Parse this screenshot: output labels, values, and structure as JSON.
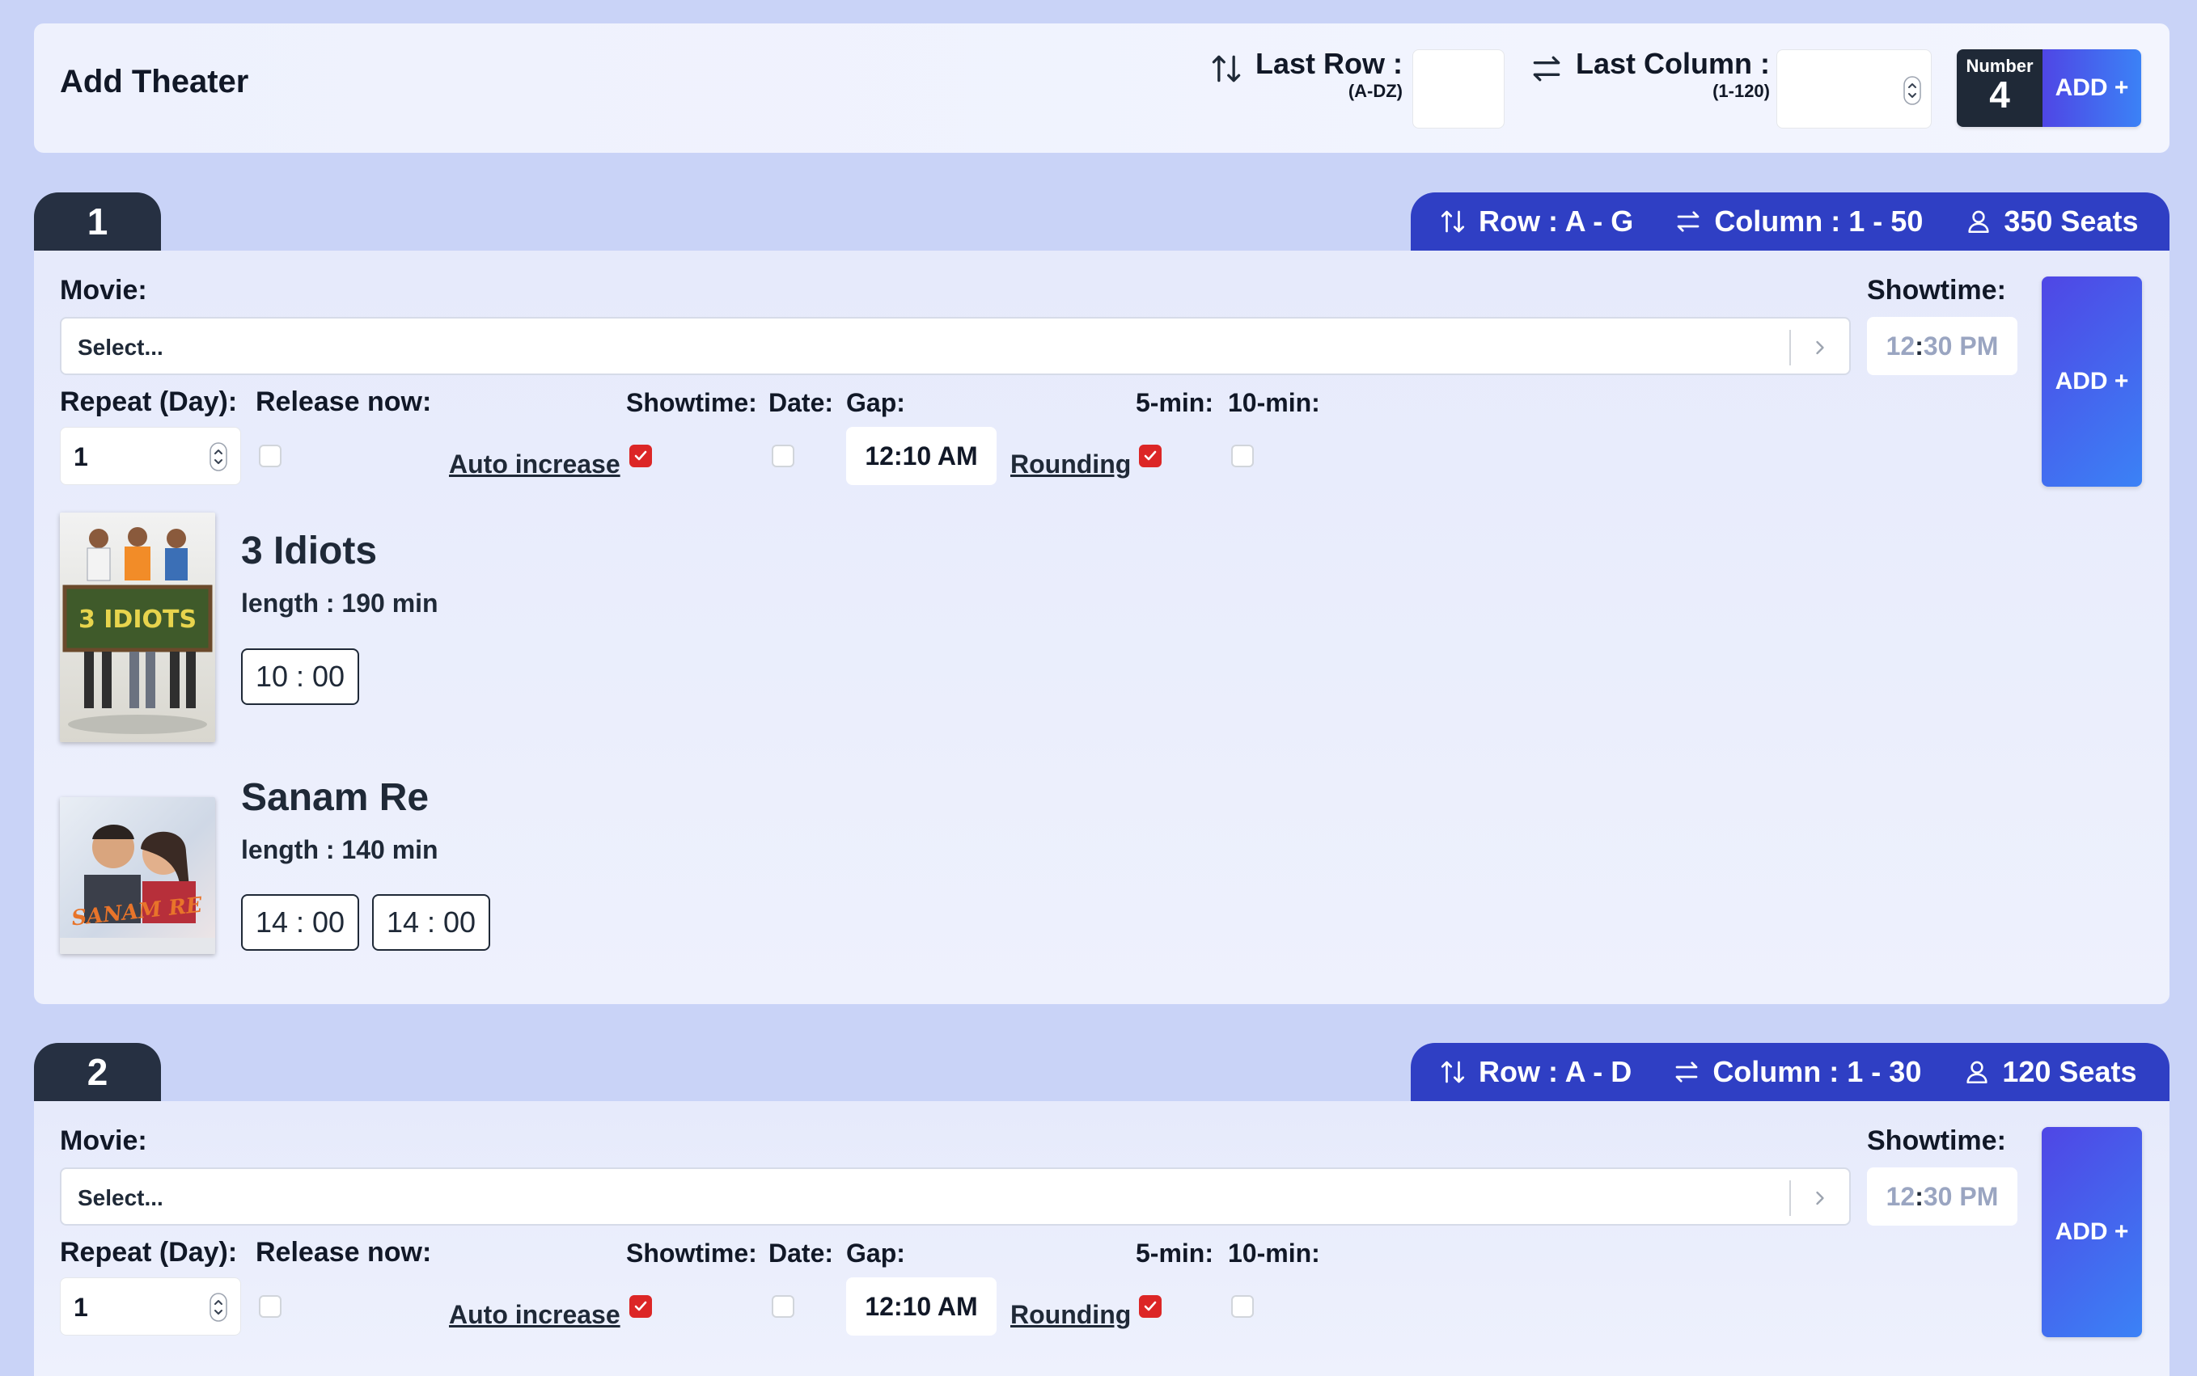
{
  "header": {
    "title": "Add Theater",
    "last_row_label": "Last Row :",
    "last_row_range": "(A-DZ)",
    "last_col_label": "Last Column :",
    "last_col_range": "(1-120)",
    "number_caption": "Number",
    "number_value": "4",
    "add_label": "ADD +"
  },
  "icons": {
    "row": "arrows-up-down-icon",
    "column": "arrows-left-right-icon",
    "seats": "user-icon",
    "chevron": "chevron-right-icon"
  },
  "colors": {
    "background": "#c9d3f7",
    "tab_dark": "#263042",
    "info_bar": "#2f3fc4",
    "add_gradient_start": "#4f46e5",
    "add_gradient_end": "#3b82f6",
    "checkbox_checked": "#dc2626"
  },
  "theaters": [
    {
      "number": "1",
      "row_info": "Row : A - G",
      "column_info": "Column : 1 - 50",
      "seats_info": "350 Seats",
      "movie_label": "Movie:",
      "movie_placeholder": "Select...",
      "showtime_label": "Showtime:",
      "showtime_hour": "12",
      "showtime_rest": "30 PM",
      "add_label": "ADD +",
      "repeat_label": "Repeat (Day):",
      "repeat_value": "1",
      "release_label": "Release now:",
      "auto_increase_label": "Auto increase",
      "showtime_check_label": "Showtime:",
      "date_label": "Date:",
      "gap_label": "Gap:",
      "gap_value": "12:10 AM",
      "rounding_label": "Rounding",
      "five_min_label": "5-min:",
      "ten_min_label": "10-min:",
      "movies": [
        {
          "title": "3 Idiots",
          "length": "length : 190 min",
          "times": [
            "10 : 00"
          ]
        },
        {
          "title": "Sanam Re",
          "length": "length : 140 min",
          "times": [
            "14 : 00",
            "14 : 00"
          ]
        }
      ]
    },
    {
      "number": "2",
      "row_info": "Row : A - D",
      "column_info": "Column : 1 - 30",
      "seats_info": "120 Seats",
      "movie_label": "Movie:",
      "movie_placeholder": "Select...",
      "showtime_label": "Showtime:",
      "showtime_hour": "12",
      "showtime_rest": "30 PM",
      "add_label": "ADD +",
      "repeat_label": "Repeat (Day):",
      "repeat_value": "1",
      "release_label": "Release now:",
      "auto_increase_label": "Auto increase",
      "showtime_check_label": "Showtime:",
      "date_label": "Date:",
      "gap_label": "Gap:",
      "gap_value": "12:10 AM",
      "rounding_label": "Rounding",
      "five_min_label": "5-min:",
      "ten_min_label": "10-min:",
      "movies": []
    }
  ],
  "posters": {
    "3_idiots_board_text": "3 IDIOTS",
    "sanam_re_text": "SANAM RE"
  }
}
